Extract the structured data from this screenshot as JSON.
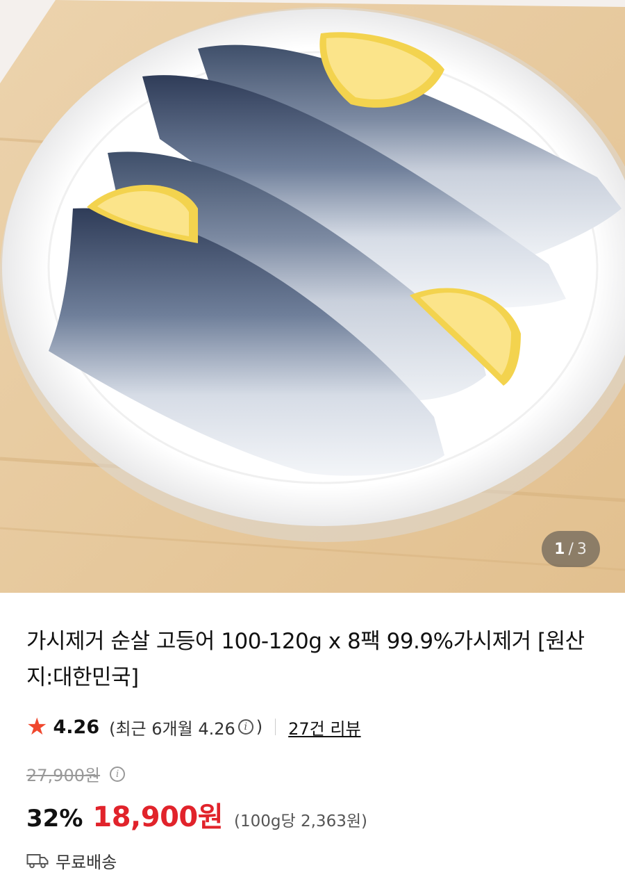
{
  "gallery": {
    "current": "1",
    "separator": "/",
    "total": "3"
  },
  "product": {
    "title": "가시제거 순살 고등어 100-120g x 8팩 99.9%가시제거 [원산지:대한민국]",
    "rating": {
      "star_icon": "star-icon",
      "score": "4.26",
      "recent_prefix": "(최근 6개월 4.26",
      "recent_suffix": ")",
      "review_link": "27건 리뷰"
    },
    "original_price": "27,900원",
    "discount": "32%",
    "sale_price": "18,900원",
    "unit_price": "(100g당 2,363원)",
    "shipping": {
      "icon": "truck-icon",
      "label": "무료배송"
    }
  },
  "colors": {
    "accent_red": "#e1232b",
    "star": "#f0482e"
  }
}
